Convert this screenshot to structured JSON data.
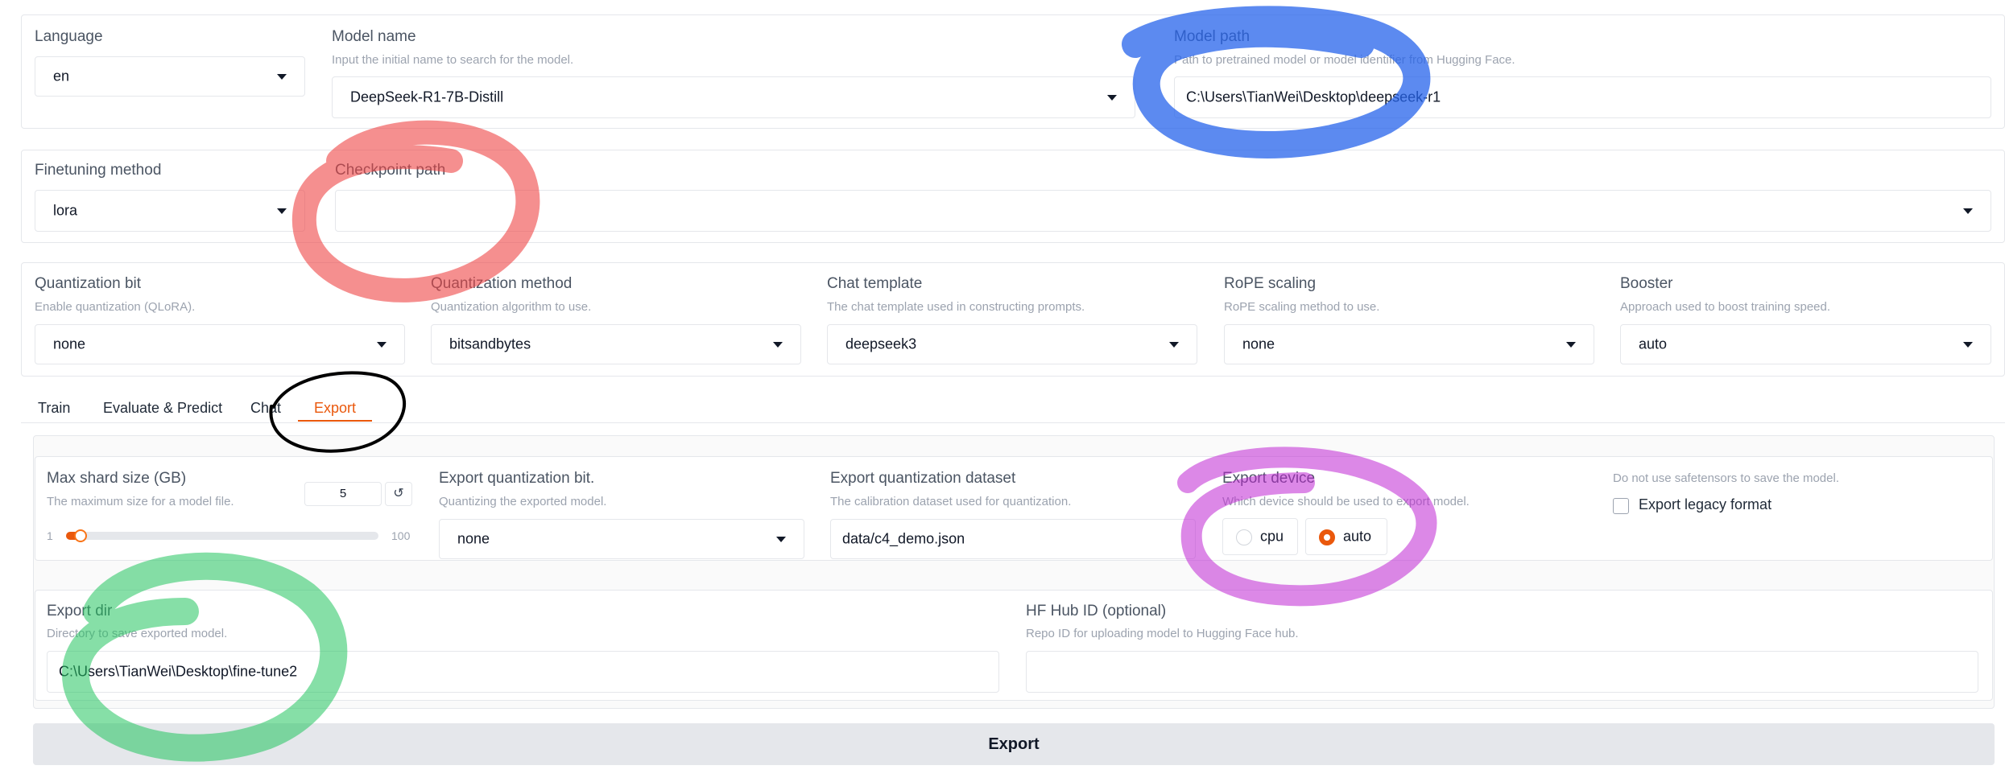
{
  "top": {
    "language": {
      "label": "Language",
      "value": "en"
    },
    "model_name": {
      "label": "Model name",
      "info": "Input the initial name to search for the model.",
      "value": "DeepSeek-R1-7B-Distill"
    },
    "model_path": {
      "label": "Model path",
      "info": "Path to pretrained model or model identifier from Hugging Face.",
      "value": "C:\\Users\\TianWei\\Desktop\\deepseek-r1"
    }
  },
  "adapter": {
    "finetuning_method": {
      "label": "Finetuning method",
      "value": "lora"
    },
    "checkpoint_path": {
      "label": "Checkpoint path",
      "value": ""
    }
  },
  "advanced": {
    "quantization_bit": {
      "label": "Quantization bit",
      "info": "Enable quantization (QLoRA).",
      "value": "none"
    },
    "quantization_method": {
      "label": "Quantization method",
      "info": "Quantization algorithm to use.",
      "value": "bitsandbytes"
    },
    "chat_template": {
      "label": "Chat template",
      "info": "The chat template used in constructing prompts.",
      "value": "deepseek3"
    },
    "rope_scaling": {
      "label": "RoPE scaling",
      "info": "RoPE scaling method to use.",
      "value": "none"
    },
    "booster": {
      "label": "Booster",
      "info": "Approach used to boost training speed.",
      "value": "auto"
    }
  },
  "tabs": [
    {
      "label": "Train",
      "active": false
    },
    {
      "label": "Evaluate & Predict",
      "active": false
    },
    {
      "label": "Chat",
      "active": false
    },
    {
      "label": "Export",
      "active": true
    }
  ],
  "export": {
    "max_shard": {
      "label": "Max shard size (GB)",
      "info": "The maximum size for a model file.",
      "value": "5",
      "min": "1",
      "max": "100",
      "reset_glyph": "↺",
      "fraction": 0.04
    },
    "quant_bit": {
      "label": "Export quantization bit.",
      "info": "Quantizing the exported model.",
      "value": "none"
    },
    "quant_dataset": {
      "label": "Export quantization dataset",
      "info": "The calibration dataset used for quantization.",
      "value": "data/c4_demo.json"
    },
    "device": {
      "label": "Export device",
      "info": "Which device should be used to export model.",
      "options": [
        "cpu",
        "auto"
      ],
      "selected": "auto"
    },
    "legacy": {
      "info": "Do not use safetensors to save the model.",
      "label": "Export legacy format",
      "checked": false
    },
    "dir": {
      "label": "Export dir",
      "info": "Directory to save exported model.",
      "value": "C:\\Users\\TianWei\\Desktop\\fine-tune2"
    },
    "hub": {
      "label": "HF Hub ID (optional)",
      "info": "Repo ID for uploading model to Hugging Face hub.",
      "value": ""
    },
    "button_label": "Export"
  },
  "colors": {
    "accent": "#ea580c",
    "annotation_blue": "#2563eb",
    "annotation_red": "#ef4444",
    "annotation_green": "#22c55e",
    "annotation_purple": "#c026d3",
    "annotation_black": "#000000"
  }
}
